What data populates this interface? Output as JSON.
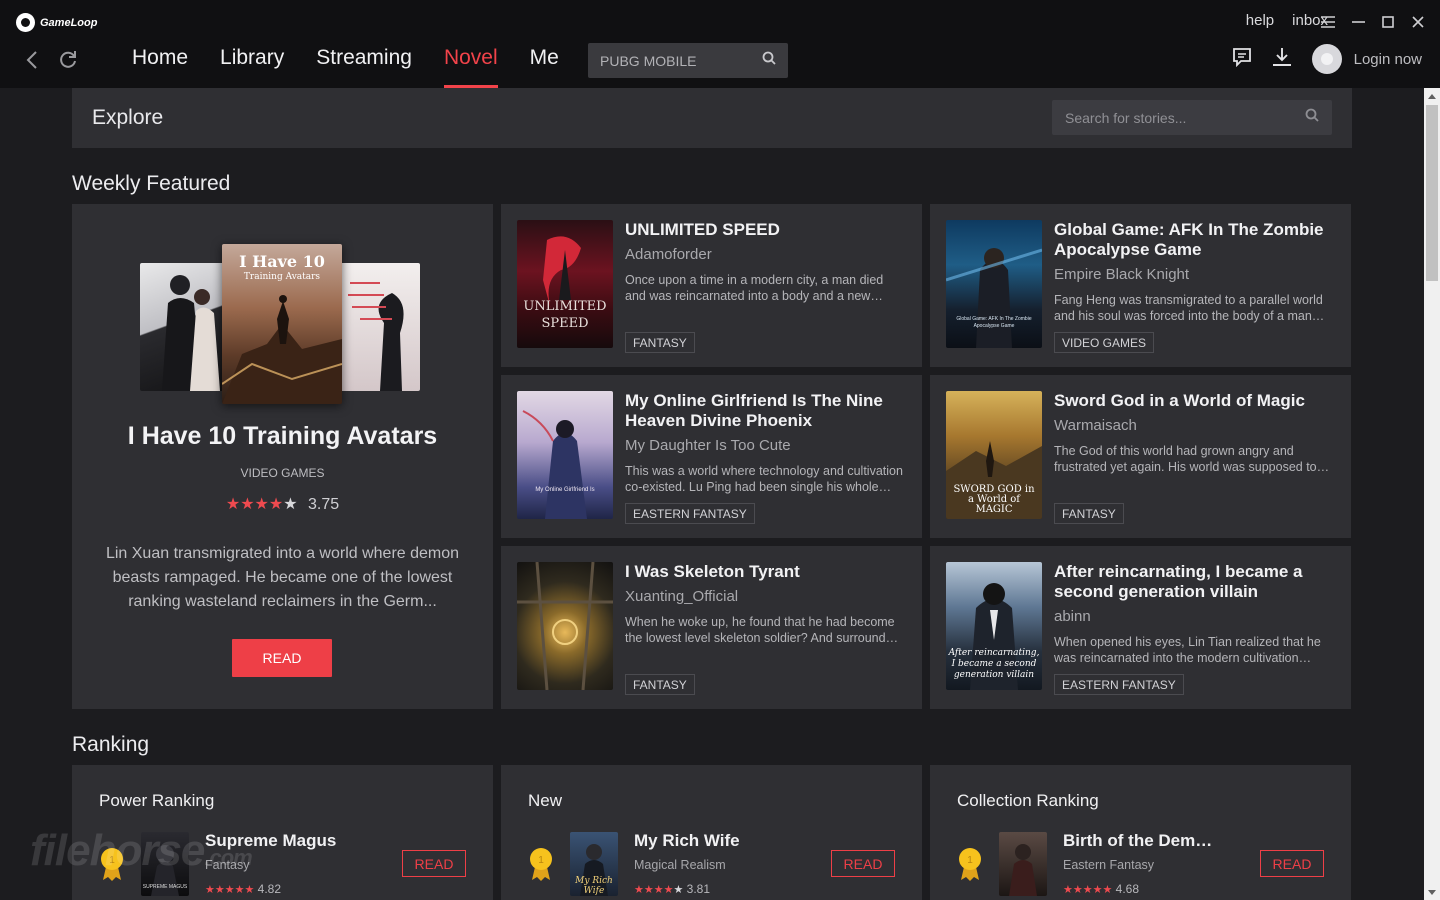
{
  "app": {
    "name": "GameLoop"
  },
  "titlebar": {
    "help": "help",
    "inbox": "inbox"
  },
  "nav": {
    "tabs": [
      {
        "label": "Home",
        "active": false
      },
      {
        "label": "Library",
        "active": false
      },
      {
        "label": "Streaming",
        "active": false
      },
      {
        "label": "Novel",
        "active": true
      },
      {
        "label": "Me",
        "active": false
      }
    ],
    "search_placeholder": "PUBG MOBILE",
    "login": "Login now"
  },
  "explore": {
    "title": "Explore",
    "search_placeholder": "Search for stories..."
  },
  "weekly": {
    "heading": "Weekly Featured",
    "featured": {
      "title": "I Have 10 Training Avatars",
      "cover_title_line1": "I Have 10",
      "cover_title_line2": "Training Avatars",
      "genre": "VIDEO GAMES",
      "rating": "3.75",
      "stars": 4,
      "description": "Lin Xuan transmigrated into a world where demon beasts rampaged. He became one of the lowest ranking wasteland reclaimers in the Germ...",
      "read": "READ"
    },
    "books": [
      {
        "title": "UNLIMITED SPEED",
        "author": "Adamoforder",
        "description": "Once upon a time in a modern city, a man died and was reincarnated into a body and a new mythical world...",
        "tag": "FANTASY",
        "cover_text": "UNLIMITED SPEED"
      },
      {
        "title": "Global Game: AFK In The Zombie Apocalypse Game",
        "author": "Empire Black Knight",
        "description": "Fang Heng was transmigrated to a parallel world and his soul was forced into the body of a man who...",
        "tag": "VIDEO GAMES",
        "cover_text": "Global Game: AFK In The Zombie Apocalypse Game"
      },
      {
        "title": "My Online Girlfriend Is The Nine Heaven Divine Phoenix",
        "author": "My Daughter Is Too Cute",
        "description": "This was a world where technology and cultivation co-existed. Lu Ping had been single his whole life...",
        "tag": "EASTERN FANTASY",
        "cover_text": "My Online Girlfriend Is"
      },
      {
        "title": "Sword God in a World of Magic",
        "author": "Warmaisach",
        "description": "The God of this world had grown angry and frustrated yet again. His world was supposed to entertain...",
        "tag": "FANTASY",
        "cover_text": "SWORD GOD in a World of MAGIC"
      },
      {
        "title": "I Was Skeleton Tyrant",
        "author": "Xuanting_Official",
        "description": "When he woke up, he found that he had become the lowest level skeleton soldier? And surrounded by...",
        "tag": "FANTASY",
        "cover_text": ""
      },
      {
        "title": "After reincarnating, I became a second generation villain",
        "author": "abinn",
        "description": "When opened his eyes, Lin Tian realized that he was reincarnated into the modern cultivation world...",
        "tag": "EASTERN FANTASY",
        "cover_text": "After reincarnating, I became a second generation villain"
      }
    ]
  },
  "ranking": {
    "heading": "Ranking",
    "lists": [
      {
        "title": "Power Ranking",
        "book": "Supreme Magus",
        "genre": "Fantasy",
        "rating": "4.82",
        "stars": 5,
        "read": "READ",
        "cover_text": "SUPREME MAGUS"
      },
      {
        "title": "New",
        "book": "My Rich Wife",
        "genre": "Magical Realism",
        "rating": "3.81",
        "stars": 4,
        "read": "READ",
        "cover_text": "My Rich Wife"
      },
      {
        "title": "Collection Ranking",
        "book": "Birth of the Demonic Sword",
        "genre": "Eastern Fantasy",
        "rating": "4.68",
        "stars": 5,
        "read": "READ",
        "cover_text": ""
      }
    ]
  },
  "watermark": {
    "text": "filehorse",
    "suffix": ".com"
  },
  "colors": {
    "accent": "#ee3f47",
    "background": "#1c1c1f",
    "card": "#2f2f33",
    "topbar": "#101012"
  }
}
